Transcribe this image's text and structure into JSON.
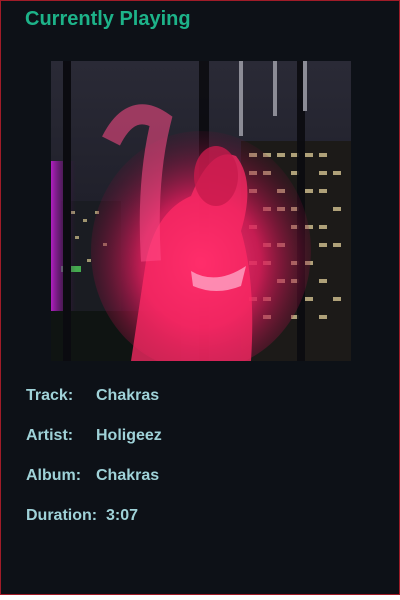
{
  "header": {
    "title": "Currently Playing"
  },
  "album_art": {
    "icon": "album-cover-image"
  },
  "track": {
    "label": "Track:",
    "value": "Chakras"
  },
  "artist": {
    "label": "Artist:",
    "value": "Holigeez"
  },
  "album": {
    "label": "Album:",
    "value": "Chakras"
  },
  "duration": {
    "label": "Duration:",
    "value": "3:07"
  },
  "colors": {
    "background": "#0d1117",
    "border": "#a01c28",
    "title": "#1db389",
    "text": "#9fd2d8"
  }
}
